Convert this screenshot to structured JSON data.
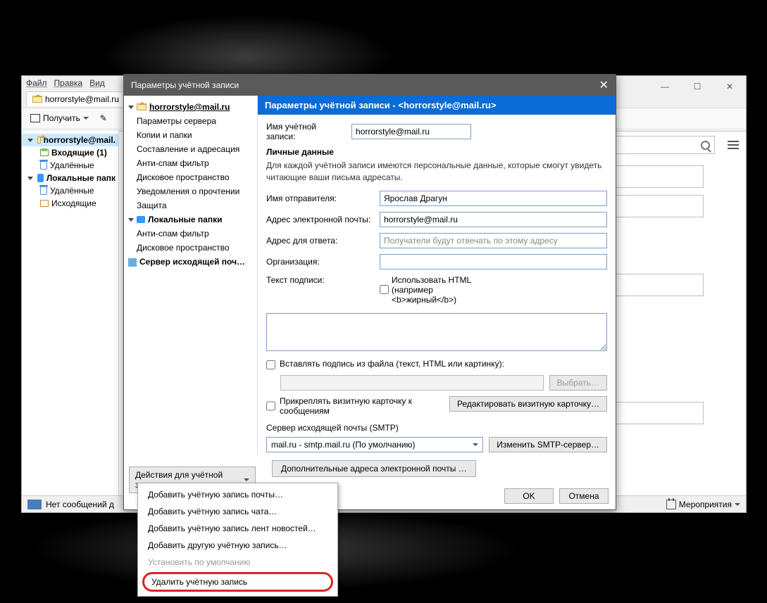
{
  "mainWindow": {
    "menu": {
      "file": "Файл",
      "edit": "Правка",
      "view": "Вид"
    },
    "tab": "horrorstyle@mail.ru",
    "toolbar": {
      "get": "Получить"
    },
    "tree": {
      "account": "horrorstyle@mail.",
      "inbox": "Входящие (1)",
      "deleted": "Удалённые",
      "localFolders": "Локальные папк",
      "deleted2": "Удалённые",
      "outgoing": "Исходящие"
    },
    "statusbar": {
      "msg": "Нет сообщений д",
      "events": "Мероприятия"
    },
    "winbtns": {
      "min": "—",
      "max": "☐",
      "close": "✕"
    }
  },
  "dialog": {
    "title": "Параметры учётной записи",
    "closeIcon": "✕",
    "tree": {
      "account": "horrorstyle@mail.ru",
      "items": [
        "Параметры сервера",
        "Копии и папки",
        "Составление и адресация",
        "Анти-спам фильтр",
        "Дисковое пространство",
        "Уведомления о прочтении",
        "Защита"
      ],
      "local": "Локальные папки",
      "localItems": [
        "Анти-спам фильтр",
        "Дисковое пространство"
      ],
      "smtp": "Сервер исходящей поч…"
    },
    "header": "Параметры учётной записи - <horrorstyle@mail.ru>",
    "accountNameLabel": "Имя учётной записи:",
    "accountName": "horrorstyle@mail.ru",
    "personalData": "Личные данные",
    "personalDesc": "Для каждой учётной записи имеются персональные данные, которые смогут увидеть читающие ваши письма адресаты.",
    "senderNameLabel": "Имя отправителя:",
    "senderName": "Ярослав Драгун",
    "emailLabel": "Адрес электронной почты:",
    "email": "horrorstyle@mail.ru",
    "replyLabel": "Адрес для ответа:",
    "replyPlaceholder": "Получатели будут отвечать по этому адресу",
    "orgLabel": "Организация:",
    "sigLabel": "Текст подписи:",
    "useHtml": "Использовать HTML (например <b>жирный</b>)",
    "insertFromFile": "Вставлять подпись из файла (текст, HTML или картинку):",
    "browse": "Выбрать…",
    "attachVcard": "Прикреплять визитную карточку к сообщениям",
    "editVcard": "Редактировать визитную карточку…",
    "smtpLabel": "Сервер исходящей почты (SMTP)",
    "smtpValue": "mail.ru - smtp.mail.ru (По умолчанию)",
    "editSmtp": "Изменить SMTP-сервер…",
    "additionalAddresses": "Дополнительные адреса электронной почты …",
    "ok": "OK",
    "cancel": "Отмена",
    "actionsBtn": "Действия для учётной записи"
  },
  "menu": {
    "addMail": "Добавить учётную запись почты…",
    "addChat": "Добавить учётную запись чата…",
    "addFeed": "Добавить учётную запись лент новостей…",
    "addOther": "Добавить другую учётную запись…",
    "setDefault": "Установить по умолчанию",
    "delete": "Удалить учётную запись"
  }
}
